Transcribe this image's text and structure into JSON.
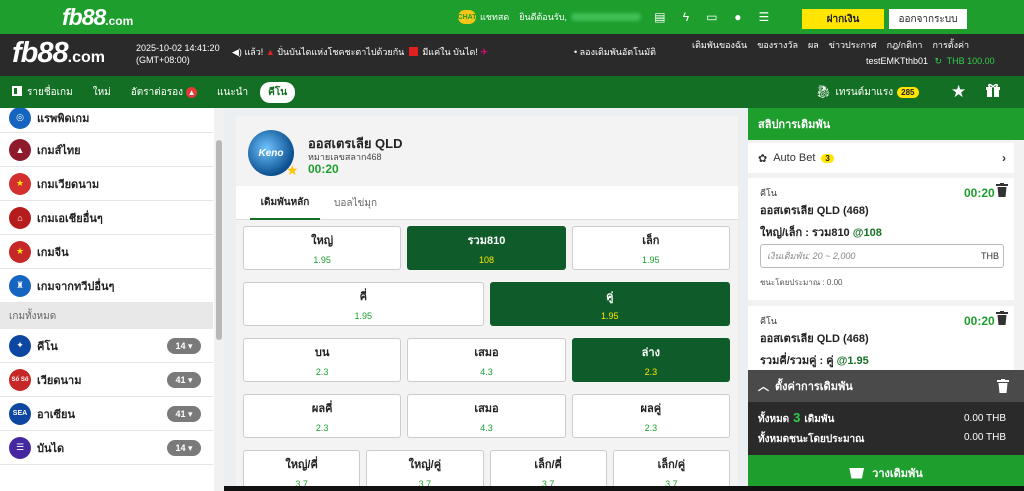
{
  "topbar": {
    "logo": "fb88",
    "logo_suffix": ".com",
    "chat_badge": "CHAT",
    "chat_label": "แชทสด",
    "welcome": "ยินดีต้อนรับ,",
    "deposit": "ฝากเงิน",
    "logout": "ออกจากระบบ"
  },
  "header": {
    "logo": "fb88",
    "logo_suffix": ".com",
    "date": "2025-10-02 14:41:20",
    "timezone": "(GMT+08:00)",
    "marquee_1": "แล้ว!",
    "marquee_2": "ปั่นบันไดแห่งโชคชะตาไปด้วยกัน",
    "marquee_3": "มีแค่ใน บันได!",
    "promo": "• ลองเดิมพันอัตโนมัติ",
    "nav": [
      "เดิมพันของฉัน",
      "ของรางวัล",
      "ผล",
      "ข่าวประกาศ",
      "กฎ/กติกา",
      "การตั้งค่า"
    ],
    "username": "testEMKTthb01",
    "balance": "THB 100.00"
  },
  "navbar": {
    "items": [
      "รายชื่อเกม",
      "ใหม่",
      "อัตราต่อรอง",
      "แนะนำ",
      "คีโน"
    ],
    "trend_label": "เทรนด์มาแรง",
    "trend_count": "285"
  },
  "sidebar": {
    "top_items": [
      {
        "label": "แรพพิดเกม",
        "color": "#1565c0"
      },
      {
        "label": "เกมส์ไทย",
        "color": "#8e1b2c"
      },
      {
        "label": "เกมเวียดนาม",
        "color": "#d32f2f"
      },
      {
        "label": "เกมเอเชียอื่นๆ",
        "color": "#b71c1c"
      },
      {
        "label": "เกมจีน",
        "color": "#c62828"
      },
      {
        "label": "เกมจากทวีปอื่นๆ",
        "color": "#1565c0"
      }
    ],
    "section_title": "เกมทั้งหมด",
    "all_items": [
      {
        "label": "คีโน",
        "count": "14",
        "color": "#0d47a1"
      },
      {
        "label": "เวียดนาม",
        "count": "41",
        "color": "#c62828",
        "badge": "Sổ Số"
      },
      {
        "label": "อาเซียน",
        "count": "41",
        "color": "#0d47a1",
        "badge": "SEA"
      },
      {
        "label": "บันได",
        "count": "14",
        "color": "#4527a0"
      }
    ]
  },
  "game": {
    "logo_text": "Keno",
    "title": "ออสเตรเลีย QLD",
    "draw": "หมายเลขสลาก468",
    "timer": "00:20",
    "tabs": [
      "เดิมพันหลัก",
      "บอลไข่มุก"
    ],
    "rows": [
      [
        {
          "label": "ใหญ่",
          "odds": "1.95",
          "selected": false
        },
        {
          "label": "รวม810",
          "odds": "108",
          "selected": true
        },
        {
          "label": "เล็ก",
          "odds": "1.95",
          "selected": false
        }
      ],
      [
        {
          "label": "คี่",
          "odds": "1.95",
          "selected": false
        },
        {
          "label": "คู่",
          "odds": "1.95",
          "selected": true
        }
      ],
      [
        {
          "label": "บน",
          "odds": "2.3",
          "selected": false
        },
        {
          "label": "เสมอ",
          "odds": "4.3",
          "selected": false
        },
        {
          "label": "ล่าง",
          "odds": "2.3",
          "selected": true
        }
      ],
      [
        {
          "label": "ผลคี่",
          "odds": "2.3",
          "selected": false
        },
        {
          "label": "เสมอ",
          "odds": "4.3",
          "selected": false
        },
        {
          "label": "ผลคู่",
          "odds": "2.3",
          "selected": false
        }
      ],
      [
        {
          "label": "ใหญ่/คี่",
          "odds": "3.7",
          "selected": false
        },
        {
          "label": "ใหญ่/คู่",
          "odds": "3.7",
          "selected": false
        },
        {
          "label": "เล็ก/คี่",
          "odds": "3.7",
          "selected": false
        },
        {
          "label": "เล็ก/คู่",
          "odds": "3.7",
          "selected": false
        }
      ]
    ]
  },
  "slip": {
    "title": "สลิปการเดิมพัน",
    "autobet_label": "Auto Bet",
    "autobet_count": "3",
    "cards": [
      {
        "game": "คีโน",
        "timer": "00:20",
        "title": "ออสเตรเลีย QLD (468)",
        "selection": "ใหญ่/เล็ก : รวม810",
        "odds": "@108",
        "placeholder": "เงินเดิมพัน: 20 ~ 2,000",
        "currency": "THB",
        "estimate": "ชนะโดยประมาณ : 0.00"
      },
      {
        "game": "คีโน",
        "timer": "00:20",
        "title": "ออสเตรเลีย QLD (468)",
        "selection": "รวมคี่/รวมคู่ : คู่",
        "odds": "@1.95"
      }
    ],
    "settings_title": "ตั้งค่าการเดิมพัน",
    "total_label": "ทั้งหมด",
    "total_count": "3",
    "total_unit": "เดิมพัน",
    "total_amount": "0.00 THB",
    "est_label": "ทั้งหมดชนะโดยประมาณ",
    "est_amount": "0.00 THB",
    "place_button": "วางเดิมพัน"
  },
  "colors": {
    "brand_green": "#1d9e2d",
    "dark_green": "#136f23",
    "selected_bet": "#0f5c2a",
    "odds_green": "#1d9e2d",
    "yellow": "#ffe500"
  }
}
